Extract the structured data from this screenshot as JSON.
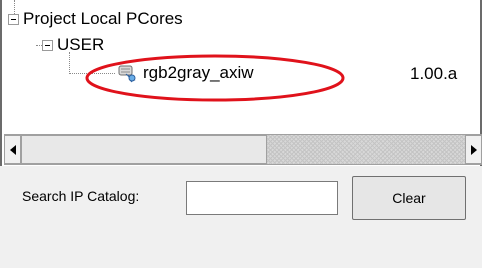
{
  "tree": {
    "root": {
      "label": "Project Local PCores"
    },
    "group": {
      "label": "USER"
    },
    "item": {
      "name": "rgb2gray_axiw",
      "version": "1.00.a",
      "icon": "ip-core-icon"
    }
  },
  "annotation": {
    "shape": "ellipse",
    "color": "#e0121b"
  },
  "search": {
    "label": "Search IP Catalog:",
    "value": "",
    "placeholder": ""
  },
  "buttons": {
    "clear_label": "Clear"
  }
}
